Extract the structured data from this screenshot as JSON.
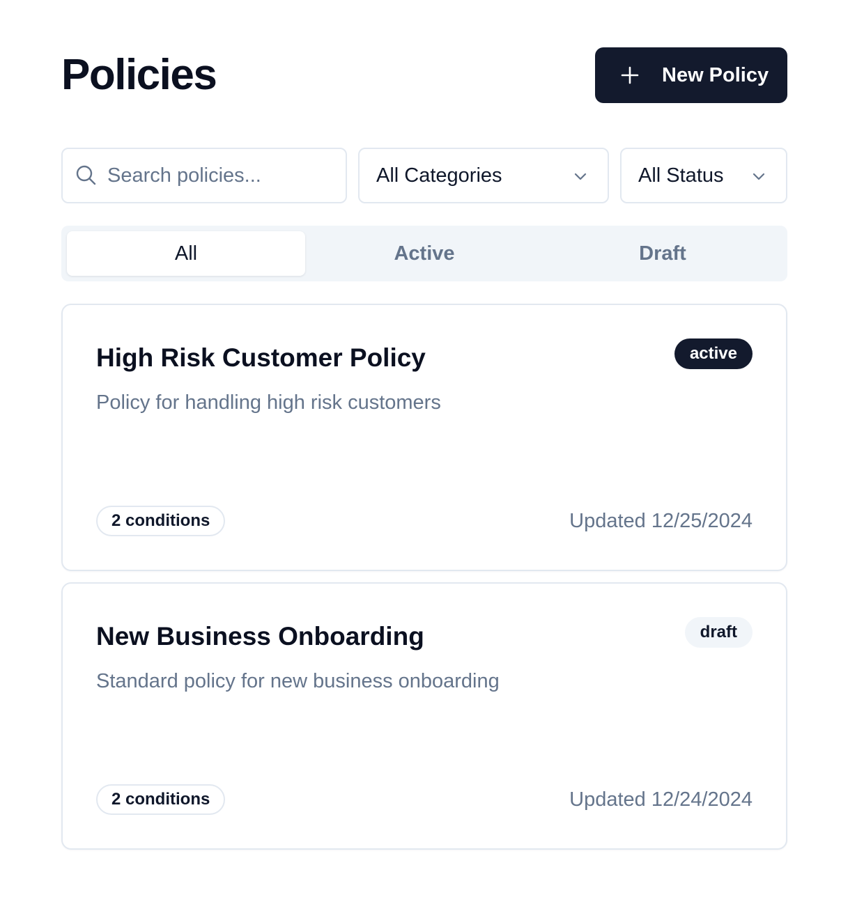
{
  "header": {
    "title": "Policies",
    "new_button_label": "New Policy"
  },
  "filters": {
    "search_placeholder": "Search policies...",
    "search_value": "",
    "category_selected": "All Categories",
    "status_selected": "All Status"
  },
  "tabs": [
    {
      "label": "All",
      "selected": true
    },
    {
      "label": "Active",
      "selected": false
    },
    {
      "label": "Draft",
      "selected": false
    }
  ],
  "policies": [
    {
      "title": "High Risk Customer Policy",
      "description": "Policy for handling high risk customers",
      "status": "active",
      "conditions": "2 conditions",
      "updated": "Updated 12/25/2024"
    },
    {
      "title": "New Business Onboarding",
      "description": "Standard policy for new business onboarding",
      "status": "draft",
      "conditions": "2 conditions",
      "updated": "Updated 12/24/2024"
    }
  ],
  "colors": {
    "primary": "#131a2d",
    "muted_text": "#64748b",
    "border": "#e2e8f0",
    "tab_bg": "#f1f5f9"
  },
  "icons": {
    "new_button": "plus-icon",
    "search": "search-icon",
    "select": "chevron-down-icon"
  }
}
